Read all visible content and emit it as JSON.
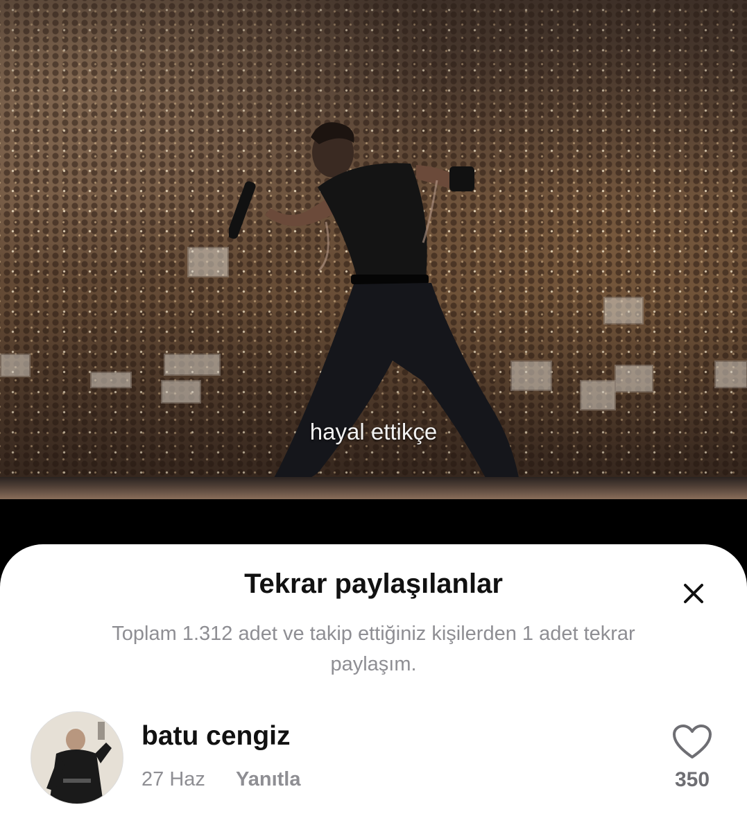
{
  "video": {
    "subtitle": "hayal ettikçe"
  },
  "sheet": {
    "title": "Tekrar paylaşılanlar",
    "close_icon": "close-icon",
    "subtitle": "Toplam 1.312 adet ve takip ettiğiniz kişilerden 1 adet tekrar paylaşım."
  },
  "reposts": [
    {
      "name": "batu cengiz",
      "date": "27 Haz",
      "reply_label": "Yanıtla",
      "likes": "350",
      "like_icon": "heart-outline-icon"
    }
  ],
  "colors": {
    "sheet_background": "#ffffff",
    "secondary_text": "#8e8e93",
    "primary_text": "#111111"
  }
}
